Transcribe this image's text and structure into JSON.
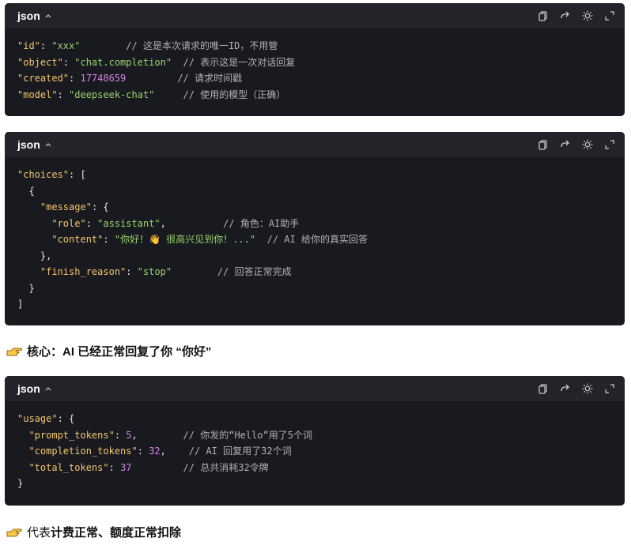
{
  "blocks": [
    {
      "lang": "json",
      "lines": [
        [
          [
            "k",
            "\"id\""
          ],
          [
            "p",
            ": "
          ],
          [
            "s",
            "\"xxx\""
          ],
          [
            "p",
            "        "
          ],
          [
            "c",
            "// 这是本次请求的唯一ID，不用管"
          ]
        ],
        [
          [
            "k",
            "\"object\""
          ],
          [
            "p",
            ": "
          ],
          [
            "s",
            "\"chat.completion\""
          ],
          [
            "p",
            "  "
          ],
          [
            "c",
            "// 表示这是一次对话回复"
          ]
        ],
        [
          [
            "k",
            "\"created\""
          ],
          [
            "p",
            ": "
          ],
          [
            "n",
            "17748659"
          ],
          [
            "p",
            "         "
          ],
          [
            "c",
            "// 请求时间戳"
          ]
        ],
        [
          [
            "k",
            "\"model\""
          ],
          [
            "p",
            ": "
          ],
          [
            "s",
            "\"deepseek-chat\""
          ],
          [
            "p",
            "     "
          ],
          [
            "c",
            "// 使用的模型（正确）"
          ]
        ]
      ]
    },
    {
      "lang": "json",
      "lines": [
        [
          [
            "k",
            "\"choices\""
          ],
          [
            "p",
            ": ["
          ]
        ],
        [
          [
            "p",
            "  {"
          ]
        ],
        [
          [
            "p",
            "    "
          ],
          [
            "k",
            "\"message\""
          ],
          [
            "p",
            ": {"
          ]
        ],
        [
          [
            "p",
            "      "
          ],
          [
            "k",
            "\"role\""
          ],
          [
            "p",
            ": "
          ],
          [
            "s",
            "\"assistant\""
          ],
          [
            "p",
            ",          "
          ],
          [
            "c",
            "// 角色：AI助手"
          ]
        ],
        [
          [
            "p",
            "      "
          ],
          [
            "k",
            "\"content\""
          ],
          [
            "p",
            ": "
          ],
          [
            "s",
            "\"你好！👋 很高兴见到你！...\""
          ],
          [
            "p",
            "  "
          ],
          [
            "c",
            "// AI 给你的真实回答"
          ]
        ],
        [
          [
            "p",
            "    },"
          ]
        ],
        [
          [
            "p",
            "    "
          ],
          [
            "k",
            "\"finish_reason\""
          ],
          [
            "p",
            ": "
          ],
          [
            "s",
            "\"stop\""
          ],
          [
            "p",
            "        "
          ],
          [
            "c",
            "// 回答正常完成"
          ]
        ],
        [
          [
            "p",
            "  }"
          ]
        ],
        [
          [
            "p",
            "]"
          ]
        ]
      ]
    },
    {
      "lang": "json",
      "lines": [
        [
          [
            "k",
            "\"usage\""
          ],
          [
            "p",
            ": {"
          ]
        ],
        [
          [
            "p",
            "  "
          ],
          [
            "k",
            "\"prompt_tokens\""
          ],
          [
            "p",
            ": "
          ],
          [
            "n",
            "5"
          ],
          [
            "p",
            ",        "
          ],
          [
            "c",
            "// 你发的“Hello”用了5个词"
          ]
        ],
        [
          [
            "p",
            "  "
          ],
          [
            "k",
            "\"completion_tokens\""
          ],
          [
            "p",
            ": "
          ],
          [
            "n",
            "32"
          ],
          [
            "p",
            ",    "
          ],
          [
            "c",
            "// AI 回复用了32个词"
          ]
        ],
        [
          [
            "p",
            "  "
          ],
          [
            "k",
            "\"total_tokens\""
          ],
          [
            "p",
            ": "
          ],
          [
            "n",
            "37"
          ],
          [
            "p",
            "         "
          ],
          [
            "c",
            "// 总共消耗32令牌"
          ]
        ],
        [
          [
            "p",
            "}"
          ]
        ]
      ]
    }
  ],
  "notes": {
    "core_prefix": "核心：AI 已经正常回复了你 “你好”",
    "bottom_plain": "代表",
    "bottom_bold": "计费正常、额度正常扣除"
  },
  "icons": [
    "copy-icon",
    "redo-icon",
    "theme-sun-icon",
    "expand-icon",
    "chevron-up-icon",
    "pointing-hand-icon"
  ]
}
